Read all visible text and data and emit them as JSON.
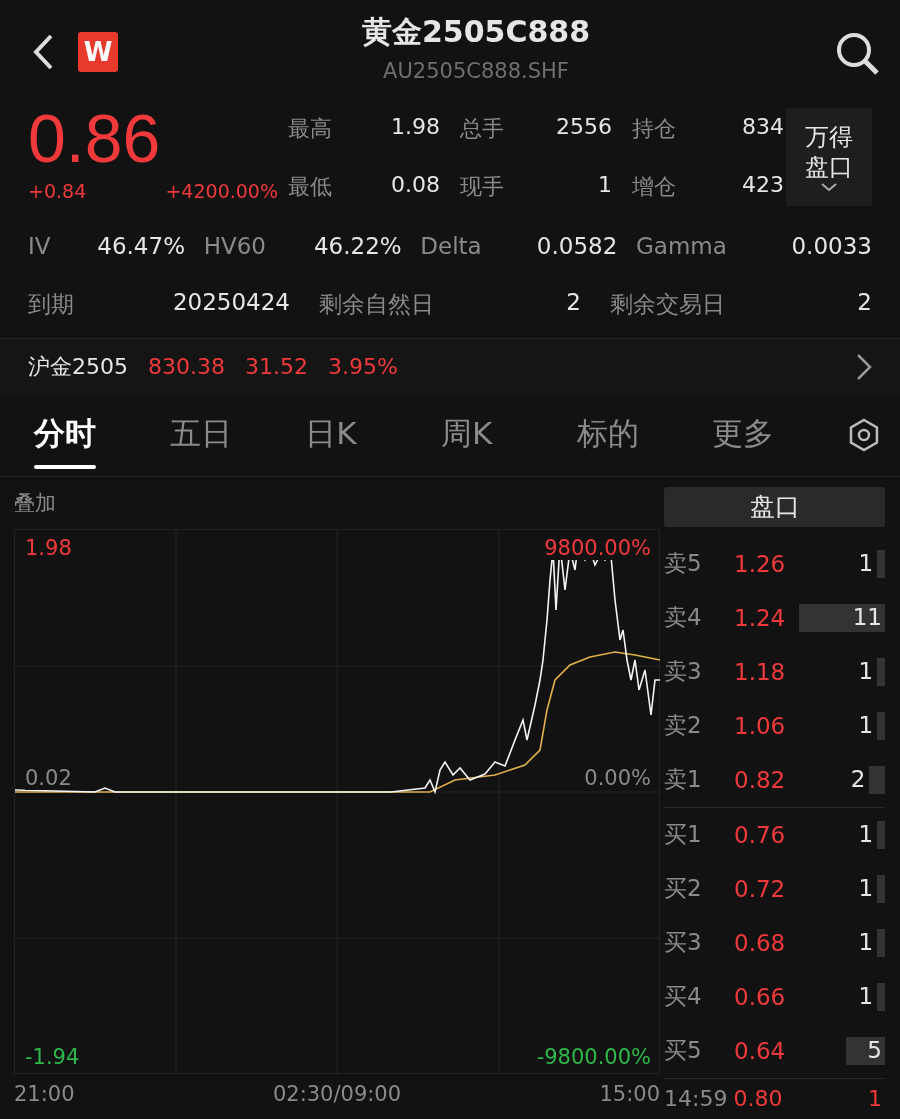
{
  "header": {
    "title": "黄金2505C888",
    "code": "AU2505C888.SHF",
    "logo": "W"
  },
  "quote": {
    "price": "0.86",
    "change": "+0.84",
    "change_pct": "+4200.00%"
  },
  "stats": [
    {
      "label": "最高",
      "value": "1.98"
    },
    {
      "label": "总手",
      "value": "2556"
    },
    {
      "label": "持仓",
      "value": "834"
    },
    {
      "label": "最低",
      "value": "0.08"
    },
    {
      "label": "现手",
      "value": "1"
    },
    {
      "label": "增仓",
      "value": "423"
    }
  ],
  "depth_button": {
    "lines": [
      "万得",
      "盘口"
    ]
  },
  "greeks": [
    {
      "label": "IV",
      "value": "46.47%"
    },
    {
      "label": "HV60",
      "value": "46.22%"
    },
    {
      "label": "Delta",
      "value": "0.0582"
    },
    {
      "label": "Gamma",
      "value": "0.0033"
    }
  ],
  "expiry": [
    {
      "label": "到期",
      "value": "20250424"
    },
    {
      "label": "剩余自然日",
      "value": "2"
    },
    {
      "label": "剩余交易日",
      "value": "2"
    }
  ],
  "underlying": {
    "name": "沪金2505",
    "price": "830.38",
    "change": "31.52",
    "change_pct": "3.95%"
  },
  "tabs": [
    {
      "label": "分时",
      "selected": true
    },
    {
      "label": "五日",
      "selected": false
    },
    {
      "label": "日K",
      "selected": false
    },
    {
      "label": "周K",
      "selected": false
    },
    {
      "label": "标的",
      "selected": false
    },
    {
      "label": "更多",
      "selected": false
    }
  ],
  "chart": {
    "overlay_label": "叠加",
    "top_price": "1.98",
    "top_pct": "9800.00%",
    "mid_price": "0.02",
    "mid_pct": "0.00%",
    "bottom_price": "-1.94",
    "bottom_pct": "-9800.00%",
    "times": [
      "21:00",
      "02:30/09:00",
      "15:00"
    ]
  },
  "order_book": {
    "title": "盘口",
    "asks": [
      {
        "label": "卖5",
        "price": "1.26",
        "qty": "1"
      },
      {
        "label": "卖4",
        "price": "1.24",
        "qty": "11"
      },
      {
        "label": "卖3",
        "price": "1.18",
        "qty": "1"
      },
      {
        "label": "卖2",
        "price": "1.06",
        "qty": "1"
      },
      {
        "label": "卖1",
        "price": "0.82",
        "qty": "2"
      }
    ],
    "bids": [
      {
        "label": "买1",
        "price": "0.76",
        "qty": "1"
      },
      {
        "label": "买2",
        "price": "0.72",
        "qty": "1"
      },
      {
        "label": "买3",
        "price": "0.68",
        "qty": "1"
      },
      {
        "label": "买4",
        "price": "0.66",
        "qty": "1"
      },
      {
        "label": "买5",
        "price": "0.64",
        "qty": "5"
      }
    ],
    "last_trade": {
      "time": "14:59",
      "price": "0.80",
      "qty": "1"
    }
  }
}
